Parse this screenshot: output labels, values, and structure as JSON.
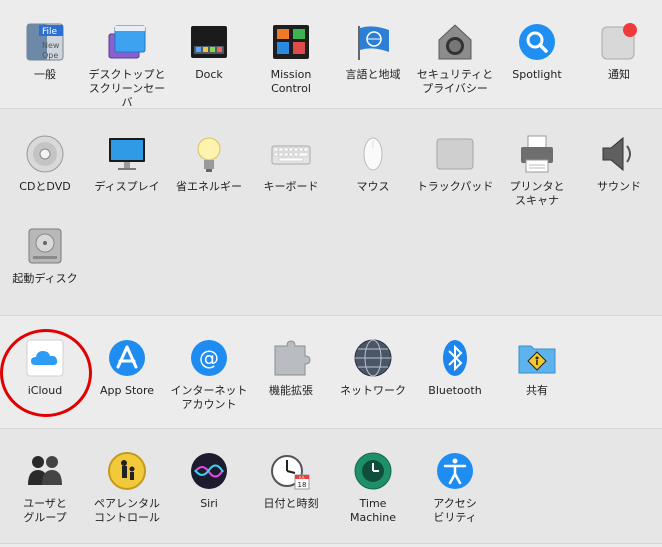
{
  "sections": [
    {
      "items": [
        {
          "label": "一般",
          "icon": "general-icon"
        },
        {
          "label": "デスクトップと\nスクリーンセーバ",
          "icon": "desktop-screensaver-icon"
        },
        {
          "label": "Dock",
          "icon": "dock-icon"
        },
        {
          "label": "Mission\nControl",
          "icon": "mission-control-icon"
        },
        {
          "label": "言語と地域",
          "icon": "language-region-icon"
        },
        {
          "label": "セキュリティと\nプライバシー",
          "icon": "security-privacy-icon"
        },
        {
          "label": "Spotlight",
          "icon": "spotlight-icon"
        },
        {
          "label": "通知",
          "icon": "notifications-icon"
        }
      ]
    },
    {
      "items": [
        {
          "label": "CDとDVD",
          "icon": "cd-dvd-icon"
        },
        {
          "label": "ディスプレイ",
          "icon": "displays-icon"
        },
        {
          "label": "省エネルギー",
          "icon": "energy-saver-icon"
        },
        {
          "label": "キーボード",
          "icon": "keyboard-icon"
        },
        {
          "label": "マウス",
          "icon": "mouse-icon"
        },
        {
          "label": "トラックパッド",
          "icon": "trackpad-icon"
        },
        {
          "label": "プリンタと\nスキャナ",
          "icon": "printers-scanners-icon"
        },
        {
          "label": "サウンド",
          "icon": "sound-icon"
        },
        {
          "label": "起動ディスク",
          "icon": "startup-disk-icon"
        }
      ]
    },
    {
      "items": [
        {
          "label": "iCloud",
          "icon": "icloud-icon"
        },
        {
          "label": "App Store",
          "icon": "app-store-icon"
        },
        {
          "label": "インターネット\nアカウント",
          "icon": "internet-accounts-icon"
        },
        {
          "label": "機能拡張",
          "icon": "extensions-icon"
        },
        {
          "label": "ネットワーク",
          "icon": "network-icon"
        },
        {
          "label": "Bluetooth",
          "icon": "bluetooth-icon"
        },
        {
          "label": "共有",
          "icon": "sharing-icon"
        }
      ]
    },
    {
      "items": [
        {
          "label": "ユーザと\nグループ",
          "icon": "users-groups-icon"
        },
        {
          "label": "ペアレンタル\nコントロール",
          "icon": "parental-controls-icon"
        },
        {
          "label": "Siri",
          "icon": "siri-icon"
        },
        {
          "label": "日付と時刻",
          "icon": "date-time-icon"
        },
        {
          "label": "Time\nMachine",
          "icon": "time-machine-icon"
        },
        {
          "label": "アクセシ\nビリティ",
          "icon": "accessibility-icon"
        }
      ]
    }
  ],
  "icon_text": {
    "general_file": "File",
    "general_new": "New",
    "general_open": "Ope",
    "calendar_month": "JUL",
    "calendar_day": "18"
  },
  "highlight": {
    "target": "iCloud",
    "color": "#e00000"
  }
}
